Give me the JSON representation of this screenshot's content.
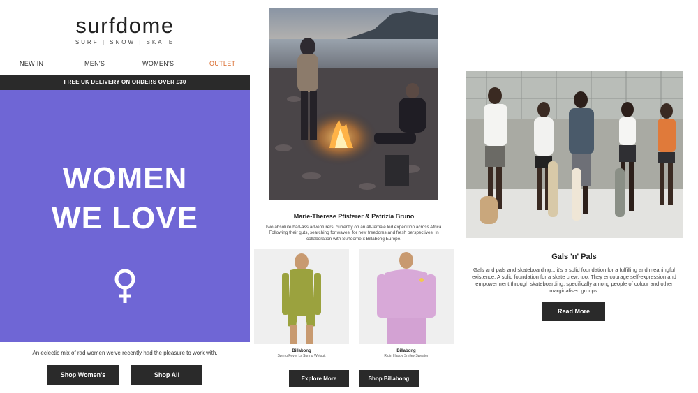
{
  "brand": {
    "name": "surfdome",
    "tagline": "SURF | SNOW | SKATE"
  },
  "nav": {
    "items": [
      {
        "label": "NEW IN"
      },
      {
        "label": "MEN'S"
      },
      {
        "label": "WOMEN'S"
      },
      {
        "label": "OUTLET",
        "color": "#d9692a"
      }
    ]
  },
  "banner": {
    "delivery": "FREE UK DELIVERY ON ORDERS OVER £30"
  },
  "hero": {
    "title_line1": "WOMEN",
    "title_line2": "WE LOVE",
    "icon": "female-symbol-icon",
    "background": "#6f66d5",
    "caption": "An eclectic mix of rad women we've recently had the pleasure to work with.",
    "buttons": {
      "shop_womens": "Shop Women's",
      "shop_all": "Shop All"
    }
  },
  "feature1": {
    "title": "Marie-Therese Pfisterer & Patrizia Bruno",
    "description": "Two absolute bad-ass adventurers, currently on an all-female led expedition across Africa. Following their guts, searching for waves, for new freedoms and fresh perspectives. In collaboration with Surfdome x Billabong Europe.",
    "products": [
      {
        "brand": "Billabong",
        "name": "Spring Fever Ls Spring Wetsuit"
      },
      {
        "brand": "Billabong",
        "name": "Ridin Happy Smiley Sweater"
      }
    ],
    "buttons": {
      "explore_more": "Explore More",
      "shop_billabong": "Shop Billabong"
    }
  },
  "feature2": {
    "title": "Gals 'n' Pals",
    "description": "Gals and pals and skateboarding... it's a solid foundation for a fulfilling and meaningful existence. A solid foundation for a skate crew, too. They encourage self-expression and empowerment through skateboarding, specifically among people of colour and other marginalised groups.",
    "button": "Read More"
  },
  "colors": {
    "dark": "#2a2a2a",
    "accent": "#d9692a",
    "hero": "#6f66d5"
  }
}
